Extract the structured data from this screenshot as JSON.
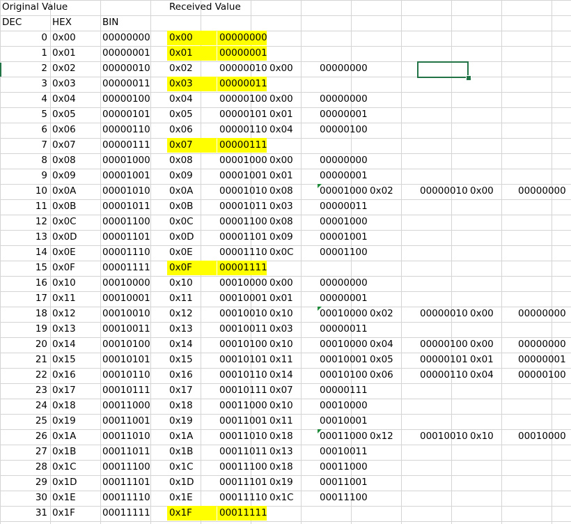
{
  "headers": {
    "original_value": "Original Value",
    "received_value": "Received Value",
    "dec": "DEC",
    "hex": "HEX",
    "bin": "BIN"
  },
  "highlight_color": "#ffff00",
  "selection_color": "#217346",
  "rows": [
    {
      "dec": "0",
      "hex": "0x00",
      "bin": "00000000",
      "rx_hex": "0x00",
      "rx_bin": "00000000",
      "highlight": true
    },
    {
      "dec": "1",
      "hex": "0x01",
      "bin": "00000001",
      "rx_hex": "0x01",
      "rx_bin": "00000001",
      "highlight": true
    },
    {
      "dec": "2",
      "hex": "0x02",
      "bin": "00000010",
      "rx_hex": "0x02",
      "rx_bin": "00000010",
      "c3_hex": "0x00",
      "c3_bin": "00000000"
    },
    {
      "dec": "3",
      "hex": "0x03",
      "bin": "00000011",
      "rx_hex": "0x03",
      "rx_bin": "00000011",
      "highlight": true
    },
    {
      "dec": "4",
      "hex": "0x04",
      "bin": "00000100",
      "rx_hex": "0x04",
      "rx_bin": "00000100",
      "c3_hex": "0x00",
      "c3_bin": "00000000"
    },
    {
      "dec": "5",
      "hex": "0x05",
      "bin": "00000101",
      "rx_hex": "0x05",
      "rx_bin": "00000101",
      "c3_hex": "0x01",
      "c3_bin": "00000001"
    },
    {
      "dec": "6",
      "hex": "0x06",
      "bin": "00000110",
      "rx_hex": "0x06",
      "rx_bin": "00000110",
      "c3_hex": "0x04",
      "c3_bin": "00000100"
    },
    {
      "dec": "7",
      "hex": "0x07",
      "bin": "00000111",
      "rx_hex": "0x07",
      "rx_bin": "00000111",
      "highlight": true
    },
    {
      "dec": "8",
      "hex": "0x08",
      "bin": "00001000",
      "rx_hex": "0x08",
      "rx_bin": "00001000",
      "c3_hex": "0x00",
      "c3_bin": "00000000"
    },
    {
      "dec": "9",
      "hex": "0x09",
      "bin": "00001001",
      "rx_hex": "0x09",
      "rx_bin": "00001001",
      "c3_hex": "0x01",
      "c3_bin": "00000001"
    },
    {
      "dec": "10",
      "hex": "0x0A",
      "bin": "00001010",
      "rx_hex": "0x0A",
      "rx_bin": "00001010",
      "c3_hex": "0x08",
      "c3_bin": "00001000",
      "c4_hex": "0x02",
      "c4_bin": "00000010",
      "c5_hex": "0x00",
      "c5_bin": "00000000",
      "note": true
    },
    {
      "dec": "11",
      "hex": "0x0B",
      "bin": "00001011",
      "rx_hex": "0x0B",
      "rx_bin": "00001011",
      "c3_hex": "0x03",
      "c3_bin": "00000011"
    },
    {
      "dec": "12",
      "hex": "0x0C",
      "bin": "00001100",
      "rx_hex": "0x0C",
      "rx_bin": "00001100",
      "c3_hex": "0x08",
      "c3_bin": "00001000"
    },
    {
      "dec": "13",
      "hex": "0x0D",
      "bin": "00001101",
      "rx_hex": "0x0D",
      "rx_bin": "00001101",
      "c3_hex": "0x09",
      "c3_bin": "00001001"
    },
    {
      "dec": "14",
      "hex": "0x0E",
      "bin": "00001110",
      "rx_hex": "0x0E",
      "rx_bin": "00001110",
      "c3_hex": "0x0C",
      "c3_bin": "00001100"
    },
    {
      "dec": "15",
      "hex": "0x0F",
      "bin": "00001111",
      "rx_hex": "0x0F",
      "rx_bin": "00001111",
      "highlight": true
    },
    {
      "dec": "16",
      "hex": "0x10",
      "bin": "00010000",
      "rx_hex": "0x10",
      "rx_bin": "00010000",
      "c3_hex": "0x00",
      "c3_bin": "00000000"
    },
    {
      "dec": "17",
      "hex": "0x11",
      "bin": "00010001",
      "rx_hex": "0x11",
      "rx_bin": "00010001",
      "c3_hex": "0x01",
      "c3_bin": "00000001"
    },
    {
      "dec": "18",
      "hex": "0x12",
      "bin": "00010010",
      "rx_hex": "0x12",
      "rx_bin": "00010010",
      "c3_hex": "0x10",
      "c3_bin": "00010000",
      "c4_hex": "0x02",
      "c4_bin": "00000010",
      "c5_hex": "0x00",
      "c5_bin": "00000000",
      "note": true
    },
    {
      "dec": "19",
      "hex": "0x13",
      "bin": "00010011",
      "rx_hex": "0x13",
      "rx_bin": "00010011",
      "c3_hex": "0x03",
      "c3_bin": "00000011"
    },
    {
      "dec": "20",
      "hex": "0x14",
      "bin": "00010100",
      "rx_hex": "0x14",
      "rx_bin": "00010100",
      "c3_hex": "0x10",
      "c3_bin": "00010000",
      "c4_hex": "0x04",
      "c4_bin": "00000100",
      "c5_hex": "0x00",
      "c5_bin": "00000000"
    },
    {
      "dec": "21",
      "hex": "0x15",
      "bin": "00010101",
      "rx_hex": "0x15",
      "rx_bin": "00010101",
      "c3_hex": "0x11",
      "c3_bin": "00010001",
      "c4_hex": "0x05",
      "c4_bin": "00000101",
      "c5_hex": "0x01",
      "c5_bin": "00000001"
    },
    {
      "dec": "22",
      "hex": "0x16",
      "bin": "00010110",
      "rx_hex": "0x16",
      "rx_bin": "00010110",
      "c3_hex": "0x14",
      "c3_bin": "00010100",
      "c4_hex": "0x06",
      "c4_bin": "00000110",
      "c5_hex": "0x04",
      "c5_bin": "00000100"
    },
    {
      "dec": "23",
      "hex": "0x17",
      "bin": "00010111",
      "rx_hex": "0x17",
      "rx_bin": "00010111",
      "c3_hex": "0x07",
      "c3_bin": "00000111"
    },
    {
      "dec": "24",
      "hex": "0x18",
      "bin": "00011000",
      "rx_hex": "0x18",
      "rx_bin": "00011000",
      "c3_hex": "0x10",
      "c3_bin": "00010000"
    },
    {
      "dec": "25",
      "hex": "0x19",
      "bin": "00011001",
      "rx_hex": "0x19",
      "rx_bin": "00011001",
      "c3_hex": "0x11",
      "c3_bin": "00010001"
    },
    {
      "dec": "26",
      "hex": "0x1A",
      "bin": "00011010",
      "rx_hex": "0x1A",
      "rx_bin": "00011010",
      "c3_hex": "0x18",
      "c3_bin": "00011000",
      "c4_hex": "0x12",
      "c4_bin": "00010010",
      "c5_hex": "0x10",
      "c5_bin": "00010000",
      "note": true
    },
    {
      "dec": "27",
      "hex": "0x1B",
      "bin": "00011011",
      "rx_hex": "0x1B",
      "rx_bin": "00011011",
      "c3_hex": "0x13",
      "c3_bin": "00010011"
    },
    {
      "dec": "28",
      "hex": "0x1C",
      "bin": "00011100",
      "rx_hex": "0x1C",
      "rx_bin": "00011100",
      "c3_hex": "0x18",
      "c3_bin": "00011000"
    },
    {
      "dec": "29",
      "hex": "0x1D",
      "bin": "00011101",
      "rx_hex": "0x1D",
      "rx_bin": "00011101",
      "c3_hex": "0x19",
      "c3_bin": "00011001"
    },
    {
      "dec": "30",
      "hex": "0x1E",
      "bin": "00011110",
      "rx_hex": "0x1E",
      "rx_bin": "00011110",
      "c3_hex": "0x1C",
      "c3_bin": "00011100"
    },
    {
      "dec": "31",
      "hex": "0x1F",
      "bin": "00011111",
      "rx_hex": "0x1F",
      "rx_bin": "00011111",
      "highlight": true
    }
  ]
}
